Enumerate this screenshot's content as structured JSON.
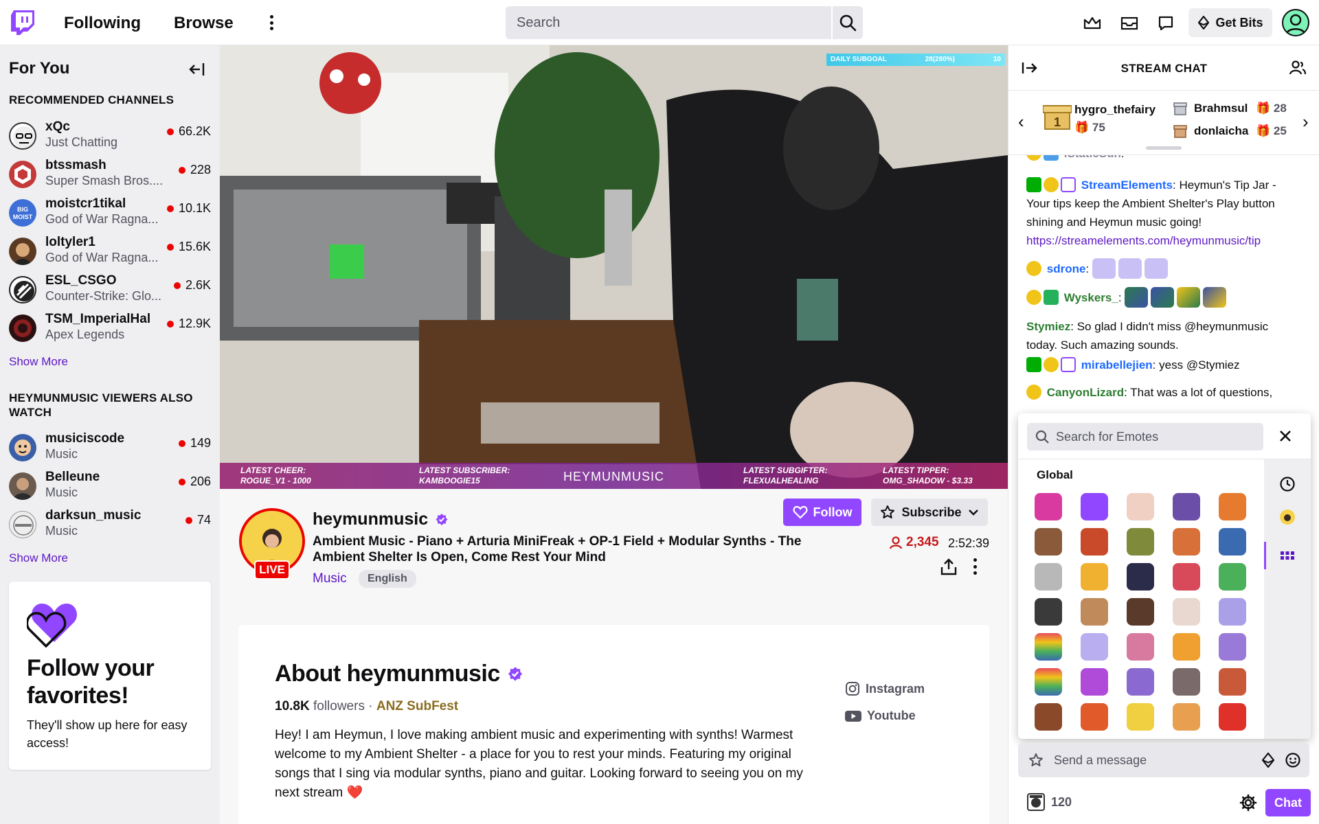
{
  "nav": {
    "following": "Following",
    "browse": "Browse",
    "search_placeholder": "Search",
    "get_bits": "Get Bits"
  },
  "sidebar": {
    "header": "For You",
    "recommended_title": "RECOMMENDED CHANNELS",
    "recommended": [
      {
        "name": "xQc",
        "game": "Just Chatting",
        "viewers": "66.2K"
      },
      {
        "name": "btssmash",
        "game": "Super Smash Bros....",
        "viewers": "228"
      },
      {
        "name": "moistcr1tikal",
        "game": "God of War Ragna...",
        "viewers": "10.1K"
      },
      {
        "name": "loltyler1",
        "game": "God of War Ragna...",
        "viewers": "15.6K"
      },
      {
        "name": "ESL_CSGO",
        "game": "Counter-Strike: Glo...",
        "viewers": "2.6K"
      },
      {
        "name": "TSM_ImperialHal",
        "game": "Apex Legends",
        "viewers": "12.9K"
      }
    ],
    "show_more": "Show More",
    "also_watch_title": "HEYMUNMUSIC VIEWERS ALSO WATCH",
    "also_watch": [
      {
        "name": "musiciscode",
        "game": "Music",
        "viewers": "149"
      },
      {
        "name": "Belleune",
        "game": "Music",
        "viewers": "206"
      },
      {
        "name": "darksun_music",
        "game": "Music",
        "viewers": "74"
      }
    ],
    "show_more_2": "Show More",
    "follow_card_title": "Follow your favorites!",
    "follow_card_text": "They'll show up here for easy access!"
  },
  "video_overlay": {
    "latest_cheer": "LATEST CHEER: ROGUE_V1 - 1000",
    "latest_subscriber": "LATEST SUBSCRIBER: KAMBOOGIE15",
    "center": "HEYMUNMUSIC",
    "latest_subgifter": "LATEST SUBGIFTER: FLEXUALHEALING",
    "latest_tipper": "LATEST TIPPER: OMG_SHADOW - $3.33",
    "subgoal_label": "DAILY SUBGOAL",
    "subgoal_value": "28(280%)",
    "subgoal_target": "10"
  },
  "stream": {
    "live": "LIVE",
    "streamer": "heymunmusic",
    "title": "Ambient Music - Piano + Arturia MiniFreak + OP-1 Field + Modular Synths - The Ambient Shelter Is Open, Come Rest Your Mind",
    "category": "Music",
    "tag": "English",
    "follow": "Follow",
    "subscribe": "Subscribe",
    "viewers": "2,345",
    "uptime": "2:52:39"
  },
  "about": {
    "title": "About heymunmusic",
    "followers_count": "10.8K",
    "followers_label": "followers",
    "separator": "·",
    "team": "ANZ SubFest",
    "bio": "Hey! I am Heymun, I love making ambient music and experimenting with synths! Warmest welcome to my Ambient Shelter - a place for you to rest your minds. Featuring my original songs that I sing via modular synths, piano and guitar. Looking forward to seeing you on my next stream ❤️",
    "instagram": "Instagram",
    "youtube": "Youtube"
  },
  "chat": {
    "title": "STREAM CHAT",
    "gifters": [
      {
        "name": "hygro_thefairy",
        "count": "75"
      },
      {
        "name": "Brahmsul",
        "count": "28"
      },
      {
        "name": "donlaicha",
        "count": "25"
      }
    ],
    "messages": [
      {
        "user": "iStaticSun",
        "text": ""
      },
      {
        "user": "StreamElements",
        "text": "Heymun's Tip Jar - Your tips keep the Ambient Shelter's Play button shining and Heymun music going!",
        "link": "https://streamelements.com/heymunmusic/tip"
      },
      {
        "user": "sdrone",
        "text": ""
      },
      {
        "user": "Wyskers_",
        "text": ""
      },
      {
        "user": "Stymiez",
        "text": "So glad I didn't miss @heymunmusic today. Such amazing sounds."
      },
      {
        "user": "mirabellejien",
        "text": "yess @Stymiez"
      },
      {
        "user": "CanyonLizard",
        "text": "That was a lot of questions,"
      }
    ],
    "colon": ":",
    "emote_search_placeholder": "Search for Emotes",
    "emote_section": "Global",
    "input_placeholder": "Send a message",
    "points": "120",
    "chat_button": "Chat"
  },
  "colors": {
    "brand": "#9147ff",
    "live": "#eb0400"
  }
}
